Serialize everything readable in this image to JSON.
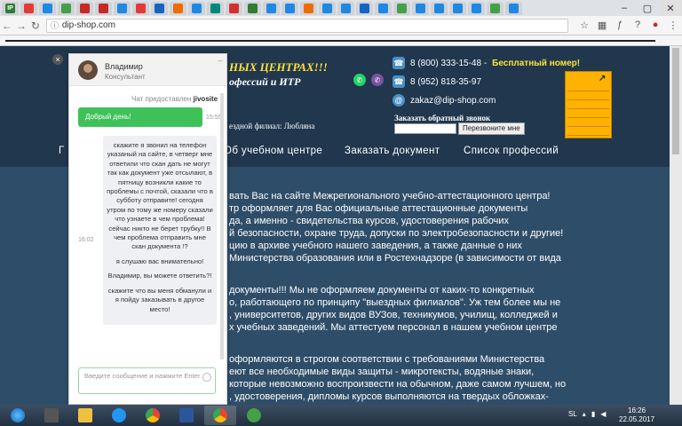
{
  "browser": {
    "url": "dip-shop.com",
    "tabs": [
      "IP",
      "",
      "",
      "",
      "",
      "",
      "",
      "",
      "",
      "",
      "",
      "",
      "",
      "",
      "",
      "",
      "",
      "",
      "",
      "",
      "",
      "",
      "",
      "",
      "",
      "",
      "",
      ""
    ]
  },
  "header": {
    "title": "НЫХ ЦЕНТРАХ!!!",
    "subtitle": "офессий и ИТР",
    "branch": "ездной филиал: Любляна",
    "phone1": "8 (800) 333-15-48 -",
    "phone1_note": "Бесплатный номер!",
    "phone2": "8 (952) 818-35-97",
    "email": "zakaz@dip-shop.com",
    "callback_label": "Заказать обратный звонок",
    "callback_button": "Перезвоните мне"
  },
  "nav": {
    "items": [
      "Г",
      "Об учебном центре",
      "Заказать документ",
      "Список профессий"
    ]
  },
  "content": {
    "p1": [
      "вать Вас на  сайте Межрегионального учебно-аттестационного центра!",
      "тр оформляет для Вас официальные аттестационные документы",
      "да, а именно - свидетельства курсов, удостоверения рабочих",
      "й безопасности, охране труда, допуски по электробезопасности и другие!",
      "цию в архиве учебного нашего заведения, а также   данные о них",
      "Министерства образования или в Ростехнадзоре (в зависимости от вида"
    ],
    "p2": [
      " документы!!! Мы не оформляем документы от каких-то конкретных",
      "о, работающего по принципу \"выездных филиалов\". Уж тем более мы не",
      ", университетов, других видов ВУЗов, техникумов, училищ, колледжей и",
      "х учебных заведений. Мы аттестуем персонал в нашем учебном центре"
    ],
    "p3": [
      "оформляются в строгом соответствии с требованиями Министерства",
      "еют все необходимые виды защиты - микротексты, водяные знаки,",
      "которые невозможно воспроизвести на обычном, даже самом лучшем, но",
      ", удостоверения, дипломы курсов выполняются на твердых обложках-"
    ]
  },
  "chat": {
    "agent_name": "Владимир",
    "agent_role": "Консультант",
    "provided_by": "Чат предоставлен",
    "provider": "jivosite",
    "outgoing_message": "Добрый день!",
    "outgoing_time": "15:55",
    "incoming_time": "16:02",
    "incoming_messages": [
      "скажите я звонил на телефон указаный на сайте, в четверг мне ответили что скан дать не могут так как документ уже отсылают, в пятницу возникли какие то проблемы с почтой, сказали что в субботу отправите! сегодня утром по тому же номеру сказали что узнаете в чем проблема!сейчас никто не берет трубку!! В чем проблема отправить мне скан документа !?",
      "я слушаю вас внимательно!",
      "Владимир, вы можете ответить?!",
      "скажите что вы меня обманули и я пойду заказывать в другое место!"
    ],
    "input_placeholder": "Введите сообщение и нажмите Enter"
  },
  "taskbar": {
    "lang": "SL",
    "time": "16:26",
    "date": "22.05.2017"
  }
}
